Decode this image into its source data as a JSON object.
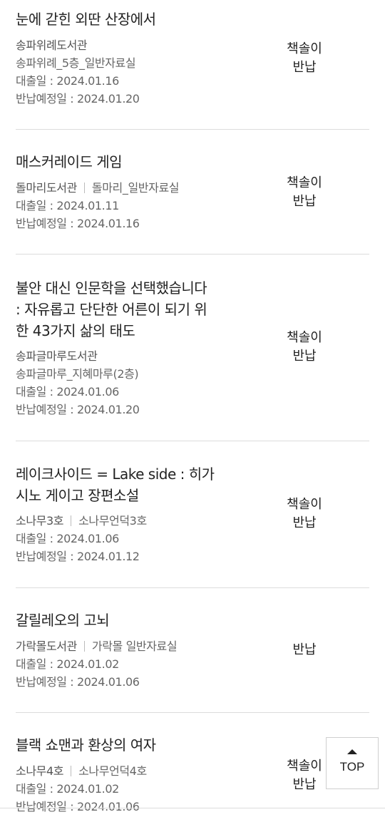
{
  "loans": [
    {
      "title_lines": [
        "눈에 갇힌 외딴 산장에서"
      ],
      "library": "송파위례도서관",
      "room": "송파위례_5층_일반자료실",
      "loan_date": "대출일 : 2024.01.16",
      "due_date": "반납예정일 : 2024.01.20",
      "status_lines": [
        "책솔이",
        "반납"
      ]
    },
    {
      "title_lines": [
        "매스커레이드 게임"
      ],
      "library": "돌마리도서관",
      "room": "돌마리_일반자료실",
      "loan_date": "대출일 : 2024.01.11",
      "due_date": "반납예정일 : 2024.01.16",
      "status_lines": [
        "책솔이",
        "반납"
      ]
    },
    {
      "title_lines": [
        "불안 대신 인문학을 선택했습니다",
        ": 자유롭고 단단한 어른이 되기 위",
        "한 43가지 삶의 태도"
      ],
      "library": "송파글마루도서관",
      "room": "송파글마루_지혜마루(2층)",
      "loan_date": "대출일 : 2024.01.06",
      "due_date": "반납예정일 : 2024.01.20",
      "status_lines": [
        "책솔이",
        "반납"
      ]
    },
    {
      "title_lines": [
        "레이크사이드 = Lake side : 히가",
        "시노 게이고 장편소설"
      ],
      "library": "소나무3호",
      "room": "소나무언덕3호",
      "loan_date": "대출일 : 2024.01.06",
      "due_date": "반납예정일 : 2024.01.12",
      "status_lines": [
        "책솔이",
        "반납"
      ]
    },
    {
      "title_lines": [
        "갈릴레오의 고뇌"
      ],
      "library": "가락몰도서관",
      "room": "가락몰 일반자료실",
      "loan_date": "대출일 : 2024.01.02",
      "due_date": "반납예정일 : 2024.01.06",
      "status_lines": [
        "반납"
      ]
    },
    {
      "title_lines": [
        "블랙 쇼맨과 환상의 여자"
      ],
      "library": "소나무4호",
      "room": "소나무언덕4호",
      "loan_date": "대출일 : 2024.01.02",
      "due_date": "반납예정일 : 2024.01.06",
      "status_lines": [
        "책솔이",
        "반납"
      ]
    }
  ],
  "top_button": {
    "label": "TOP",
    "icon": "arrow-up-icon"
  }
}
